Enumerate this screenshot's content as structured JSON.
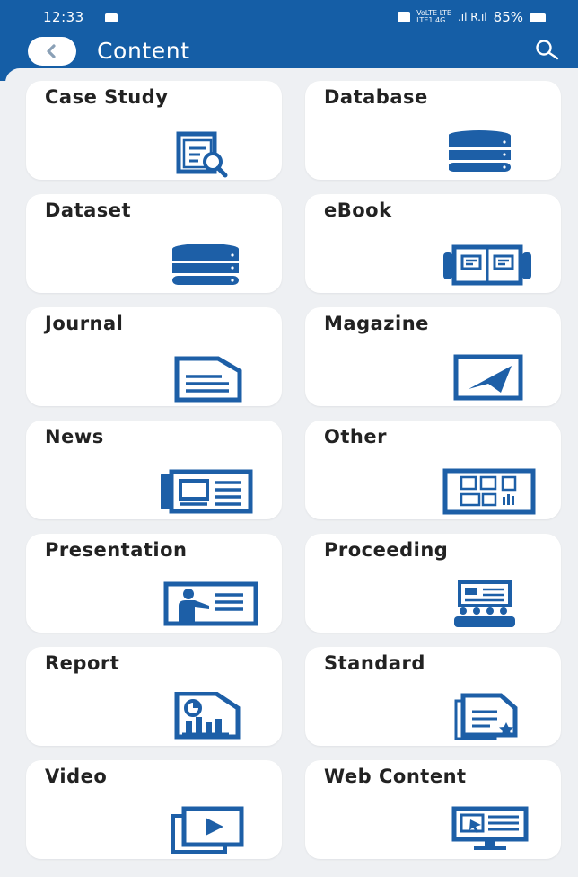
{
  "status_bar": {
    "time": "12:33",
    "network_top": "VoLTE LTE",
    "network_bottom": "LTE1 4G",
    "signal_text": ".ıl R.ıl",
    "battery": "85%"
  },
  "header": {
    "title": "Content"
  },
  "categories": [
    {
      "label": "Case Study",
      "icon": "case-study-icon"
    },
    {
      "label": "Database",
      "icon": "database-icon"
    },
    {
      "label": "Dataset",
      "icon": "dataset-icon"
    },
    {
      "label": "eBook",
      "icon": "ebook-icon"
    },
    {
      "label": "Journal",
      "icon": "journal-icon"
    },
    {
      "label": "Magazine",
      "icon": "magazine-icon"
    },
    {
      "label": "News",
      "icon": "news-icon"
    },
    {
      "label": "Other",
      "icon": "other-icon"
    },
    {
      "label": "Presentation",
      "icon": "presentation-icon"
    },
    {
      "label": "Proceeding",
      "icon": "proceeding-icon"
    },
    {
      "label": "Report",
      "icon": "report-icon"
    },
    {
      "label": "Standard",
      "icon": "standard-icon"
    },
    {
      "label": "Video",
      "icon": "video-icon"
    },
    {
      "label": "Web Content",
      "icon": "web-content-icon"
    }
  ],
  "colors": {
    "header": "#155ea6",
    "icon": "#1d5fa7",
    "background": "#eef0f3",
    "card": "#ffffff",
    "text": "#222222"
  }
}
